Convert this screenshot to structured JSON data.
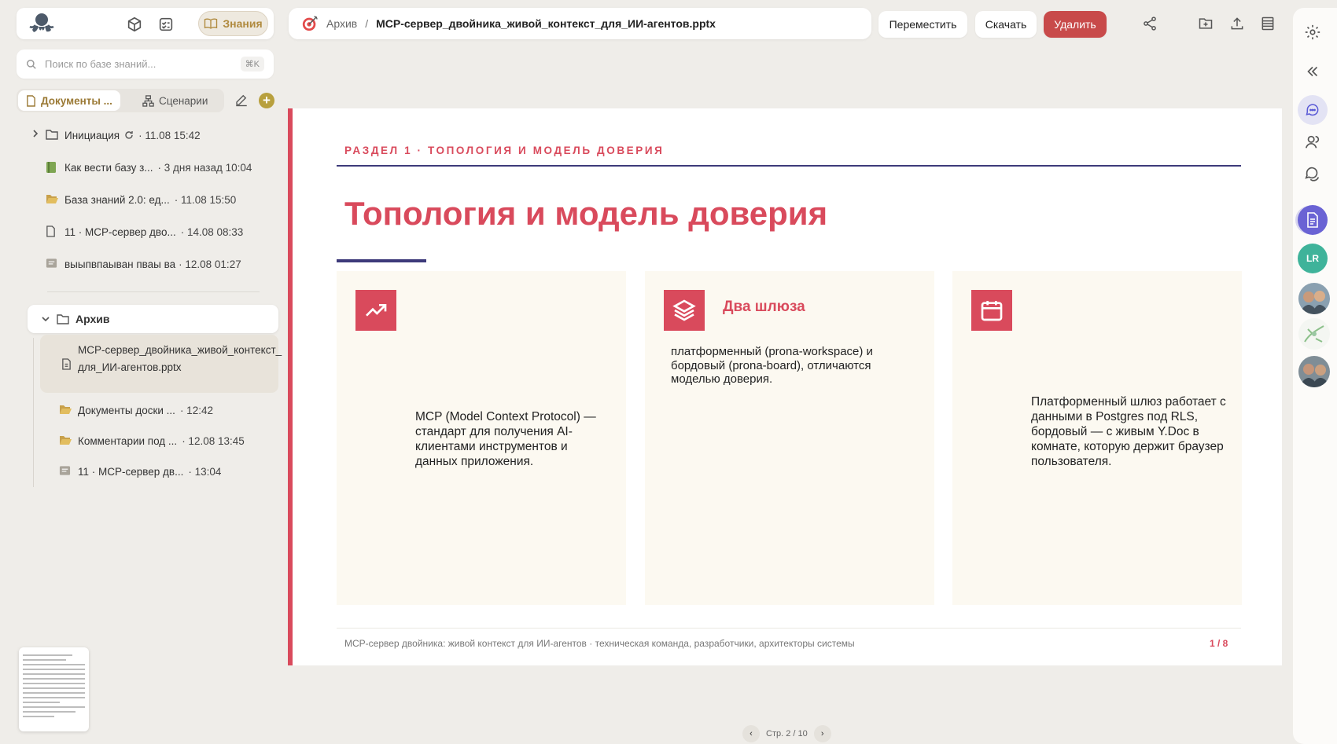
{
  "colors": {
    "accent": "#d94a5c",
    "navy": "#3d3a7a",
    "gold": "#b08a3e",
    "danger": "#c84a4a",
    "card_bg": "#fcf9f1",
    "avatar_lr": "#3fb39a"
  },
  "app": {
    "knowledge_label": "Знания"
  },
  "search": {
    "placeholder": "Поиск по базе знаний...",
    "shortcut": "⌘K"
  },
  "sidebar": {
    "tabs": [
      {
        "label": "Документы ...",
        "icon": "document-icon"
      },
      {
        "label": "Сценарии",
        "icon": "flow-icon"
      }
    ],
    "items": [
      {
        "name": "Инициация",
        "meta": "· 11.08 15:42",
        "icon": "folder-icon"
      },
      {
        "name": "Как вести базу з...",
        "meta": "· 3 дня назад 10:04",
        "icon": "book-icon"
      },
      {
        "name": "База знаний 2.0: ед...",
        "meta": "· 11.08 15:50",
        "icon": "folder-open-icon"
      },
      {
        "name": "11 · MCP-сервер дво...",
        "meta": "· 14.08 08:33",
        "icon": "document-icon"
      },
      {
        "name": "выыпвпаыван пваы ва",
        "meta": "· 12.08 01:27",
        "icon": "note-icon"
      }
    ],
    "archive": {
      "label": "Архив",
      "selected": "MCP-сервер_двойника_живой_контекст_для_ИИ-агентов.pptx",
      "children": [
        {
          "name": "Документы доски ...",
          "meta": "· 12:42",
          "icon": "folder-open-icon"
        },
        {
          "name": "Комментарии под ...",
          "meta": "· 12.08 13:45",
          "icon": "folder-open-icon"
        },
        {
          "name": "11 · MCP-сервер дв...",
          "meta": "· 13:04",
          "icon": "note-icon"
        }
      ]
    }
  },
  "header": {
    "breadcrumb_parent": "Архив",
    "separator": "/",
    "filename": "MCP-сервер_двойника_живой_контекст_для_ИИ-агентов.pptx",
    "move_label": "Переместить",
    "download_label": "Скачать",
    "delete_label": "Удалить"
  },
  "slide": {
    "kicker": "РАЗДЕЛ 1 · ТОПОЛОГИЯ И МОДЕЛЬ ДОВЕРИЯ",
    "title": "Топология и модель доверия",
    "cards": [
      {
        "icon": "trending-up-icon",
        "heading": "",
        "text": "MCP (Model Context Protocol) — стандарт для получения AI-клиентами инструментов и данных приложения."
      },
      {
        "icon": "layers-icon",
        "heading": "Два шлюза",
        "text": "платформенный (prona-workspace) и бордовый (prona-board), отличаются моделью доверия."
      },
      {
        "icon": "calendar-icon",
        "heading": "",
        "text": "Платформенный шлюз работает с данными в Postgres под RLS, бордовый — с живым Y.Doc в комнате, которую держит браузер пользователя."
      }
    ],
    "footer": "MCP-сервер двойника: живой контекст для ИИ-агентов · техническая команда, разработчики, архитекторы системы",
    "page_indicator": "1 / 8"
  },
  "pager": {
    "label": "Стр. 2 / 10",
    "prev": "‹",
    "next": "›"
  },
  "rail": {
    "avatar_initials": "LR"
  }
}
